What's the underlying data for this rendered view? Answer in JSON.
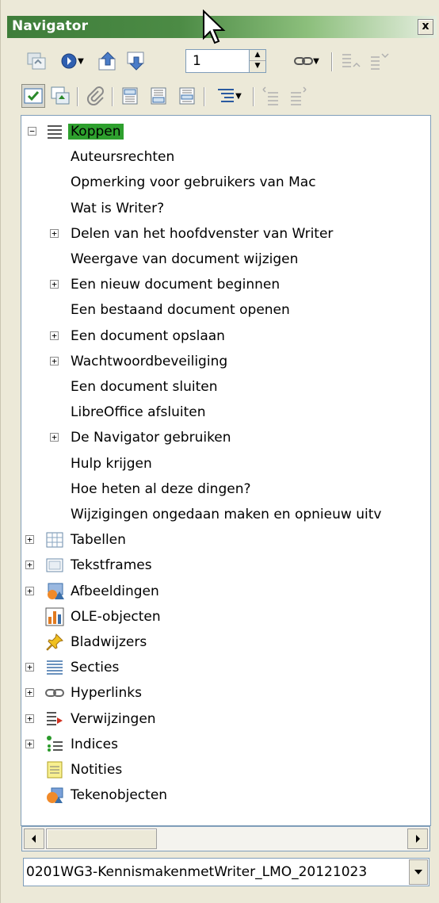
{
  "window": {
    "title": "Navigator",
    "close_glyph": "x"
  },
  "toolbar": {
    "page_number": "1"
  },
  "tree": {
    "root": {
      "label": "Koppen"
    },
    "headings": [
      {
        "label": "Auteursrechten",
        "expandable": false
      },
      {
        "label": "Opmerking voor gebruikers van Mac",
        "expandable": false
      },
      {
        "label": "Wat is Writer?",
        "expandable": false
      },
      {
        "label": "Delen van het hoofdvenster van Writer",
        "expandable": true
      },
      {
        "label": "Weergave van document wijzigen",
        "expandable": false
      },
      {
        "label": "Een nieuw document beginnen",
        "expandable": true
      },
      {
        "label": "Een bestaand document openen",
        "expandable": false
      },
      {
        "label": "Een document opslaan",
        "expandable": true
      },
      {
        "label": "Wachtwoordbeveiliging",
        "expandable": true
      },
      {
        "label": "Een document sluiten",
        "expandable": false
      },
      {
        "label": "LibreOffice afsluiten",
        "expandable": false
      },
      {
        "label": "De Navigator gebruiken",
        "expandable": true
      },
      {
        "label": "Hulp krijgen",
        "expandable": false
      },
      {
        "label": "Hoe heten al deze dingen?",
        "expandable": false
      },
      {
        "label": "Wijzigingen ongedaan maken en opnieuw uitv",
        "expandable": false
      }
    ],
    "categories": [
      {
        "label": "Tabellen",
        "icon": "table-icon",
        "expandable": true
      },
      {
        "label": "Tekstframes",
        "icon": "frame-icon",
        "expandable": true
      },
      {
        "label": "Afbeeldingen",
        "icon": "image-icon",
        "expandable": true
      },
      {
        "label": "OLE-objecten",
        "icon": "ole-chart-icon",
        "expandable": false
      },
      {
        "label": "Bladwijzers",
        "icon": "bookmark-pin-icon",
        "expandable": false
      },
      {
        "label": "Secties",
        "icon": "section-icon",
        "expandable": true
      },
      {
        "label": "Hyperlinks",
        "icon": "hyperlink-icon",
        "expandable": true
      },
      {
        "label": "Verwijzingen",
        "icon": "reference-icon",
        "expandable": true
      },
      {
        "label": "Indices",
        "icon": "index-icon",
        "expandable": true
      },
      {
        "label": "Notities",
        "icon": "note-icon",
        "expandable": false
      },
      {
        "label": "Tekenobjecten",
        "icon": "drawing-object-icon",
        "expandable": false
      }
    ]
  },
  "document_select": {
    "value": "0201WG3-KennismakenmetWriter_LMO_20121023"
  },
  "colors": {
    "title_gradient_start": "#3e7d3a",
    "selection": "#2ea02e"
  }
}
